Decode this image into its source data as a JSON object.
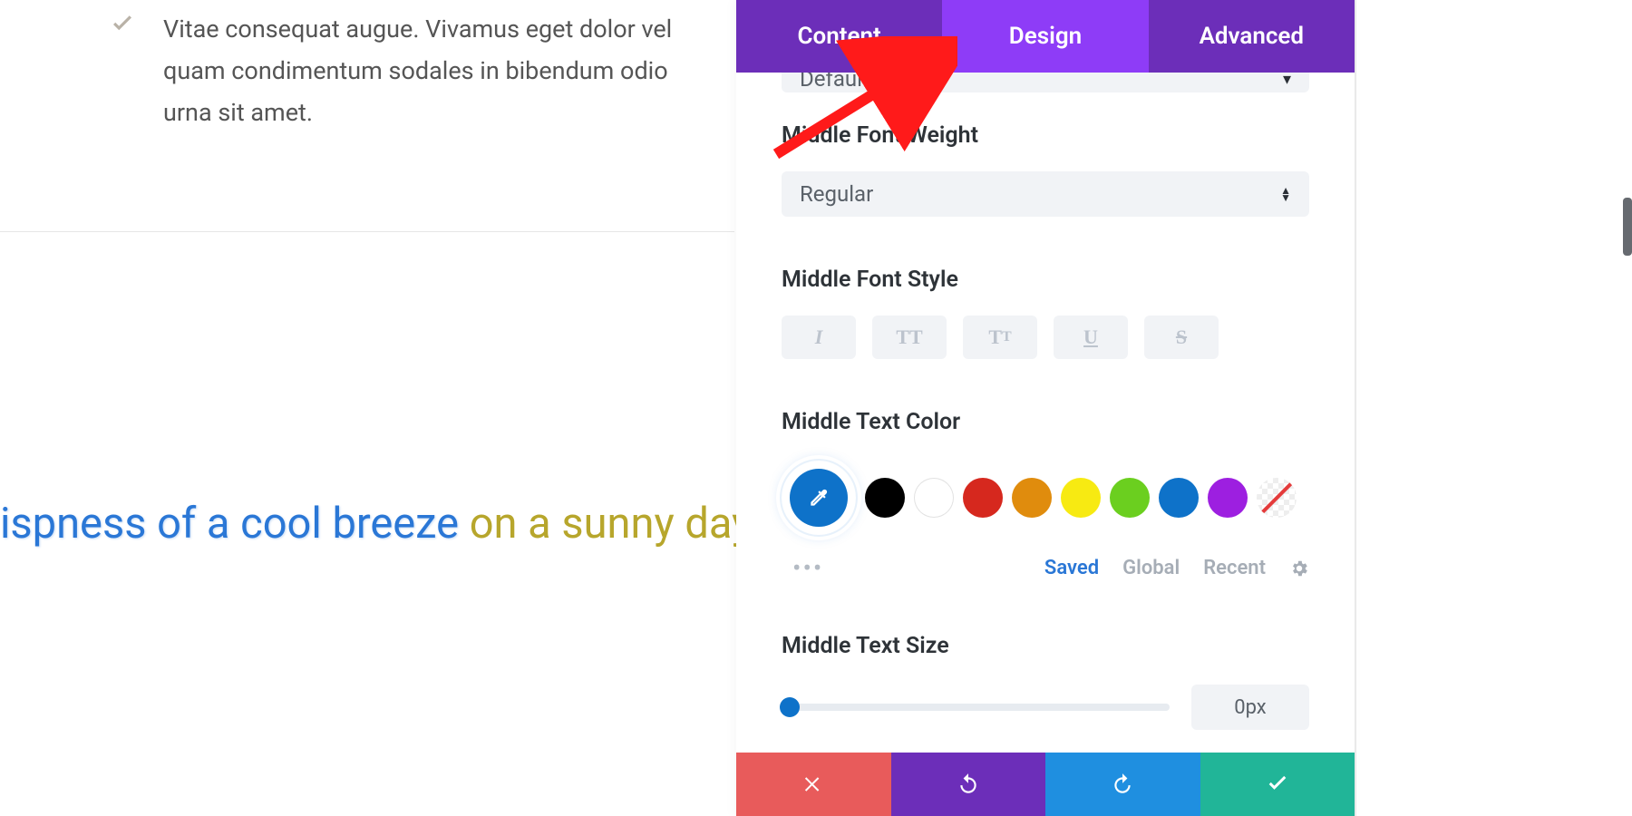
{
  "left": {
    "bullet_text": "Vitae consequat augue. Vivamus eget dolor vel quam condimentum sodales in bibendum odio urna sit amet.",
    "preview_blue": "ispness of a cool breeze ",
    "preview_olive": "on a sunny day"
  },
  "tabs": {
    "content": "Content",
    "design": "Design",
    "advanced": "Advanced"
  },
  "partial_select": {
    "value": "Default"
  },
  "sections": {
    "font_weight_label": "Middle Font Weight",
    "font_weight_value": "Regular",
    "font_style_label": "Middle Font Style",
    "text_color_label": "Middle Text Color",
    "text_size_label": "Middle Text Size",
    "text_size_value": "0px"
  },
  "style_buttons": {
    "italic": "I",
    "uppercase": "TT",
    "smallcaps_big": "T",
    "smallcaps_small": "T",
    "underline": "U",
    "strike": "S"
  },
  "colors": {
    "swatches": [
      "#000000",
      "#ffffff",
      "#d6281e",
      "#e08c0d",
      "#f7ea12",
      "#6bcf1f",
      "#0e72c9",
      "#9d1fe0"
    ]
  },
  "palette_tabs": {
    "saved": "Saved",
    "global": "Global",
    "recent": "Recent"
  }
}
